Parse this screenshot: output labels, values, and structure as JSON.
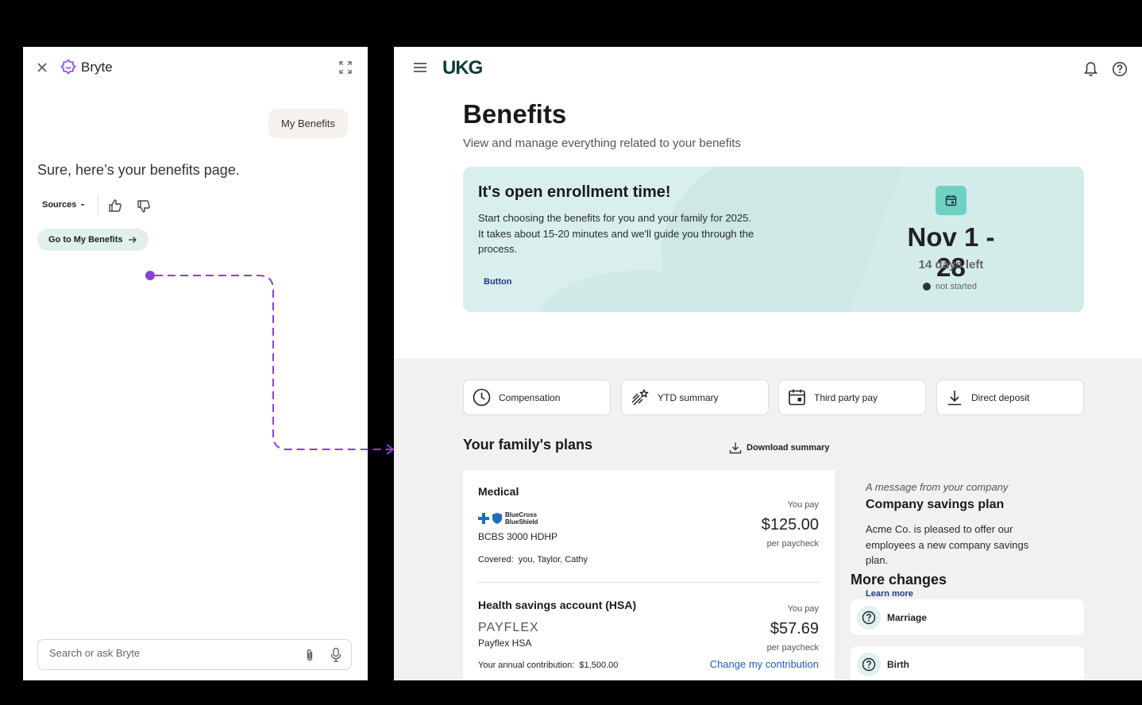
{
  "assistant": {
    "title": "Bryte",
    "user_message": "My Benefits",
    "bot_message": "Sure, here’s your benefits page.",
    "sources_label": "Sources",
    "goto_button": "Go to My Benefits",
    "input_placeholder": "Search or ask Bryte",
    "accent": "#8b3fd9"
  },
  "header": {
    "logo": "UKG"
  },
  "page": {
    "title": "Benefits",
    "subtitle": "View and manage everything related to your benefits"
  },
  "enrollment": {
    "title": "It's open enrollment time!",
    "text": "Start choosing the benefits for you and your family for 2025. It takes about 15-20 minutes and we'll guide you through the process.",
    "button": "Button",
    "dates": "Nov 1 - 28",
    "days_left": "14 days left",
    "status": "not started"
  },
  "quick_links": [
    {
      "label": "Compensation",
      "icon": "clock-icon"
    },
    {
      "label": "YTD summary",
      "icon": "shooting-star-icon"
    },
    {
      "label": "Third party pay",
      "icon": "calendar-icon"
    },
    {
      "label": "Direct deposit",
      "icon": "download-icon"
    }
  ],
  "plans": {
    "title": "Your family's plans",
    "download": "Download summary",
    "medical": {
      "name": "Medical",
      "provider_logo": "BlueCross BlueShield",
      "provider_logo_line1": "BlueCross",
      "provider_logo_line2": "BlueShield",
      "plan": "BCBS 3000 HDHP",
      "covered_label": "Covered:",
      "covered": "you, Taylor, Cathy",
      "you_pay_label": "You pay",
      "amount": "$125.00",
      "per": "per paycheck"
    },
    "hsa": {
      "name": "Health savings account (HSA)",
      "provider_logo": "PAYFLEX",
      "plan": "Payflex HSA",
      "contribution_label": "Your annual contribution:",
      "contribution": "$1,500.00",
      "you_pay_label": "You pay",
      "amount": "$57.69",
      "per": "per paycheck",
      "change_link": "Change my contribution"
    }
  },
  "company_message": {
    "note": "A message from your company",
    "title": "Company savings plan",
    "body": "Acme Co. is pleased to offer our employees a new company savings plan."
  },
  "more_changes": {
    "title": "More changes",
    "learn_more": "Learn more",
    "items": [
      {
        "label": "Marriage"
      },
      {
        "label": "Birth"
      }
    ]
  }
}
